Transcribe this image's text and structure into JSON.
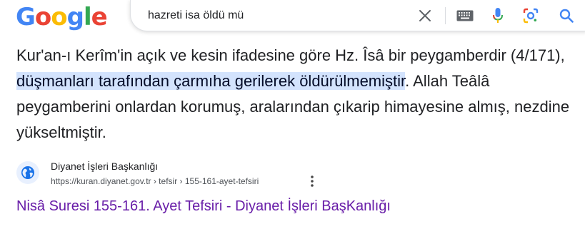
{
  "logo": {
    "letters": [
      "G",
      "o",
      "o",
      "g",
      "l",
      "e"
    ],
    "colors": [
      "#4285f4",
      "#ea4335",
      "#fbbc05",
      "#4285f4",
      "#34a853",
      "#ea4335"
    ]
  },
  "search": {
    "query": "hazreti isa öldü mü",
    "icons": [
      "close-icon",
      "keyboard-icon",
      "microphone-icon",
      "lens-icon",
      "search-icon"
    ]
  },
  "snippet": {
    "text_before": "Kur'an-ı Kerîm'in açık ve kesin ifadesine göre Hz. Îsâ bir peygamberdir (4/171), ",
    "highlight": "düşmanları tarafından çarmıha gerilerek öldürülmemiştir",
    "text_after": ". Allah Teâlâ peygamberini onlardan korumuş, aralarından çıkarip himayesine almış, nezdine yükseltmiştir.",
    "highlight_color": "#d3e3fd"
  },
  "result": {
    "site_name": "Diyanet İşleri Başkanlığı",
    "url": "https://kuran.diyanet.gov.tr › tefsir › 155-161-ayet-tefsiri",
    "title": "Nisâ Suresi 155-161. Ayet Tefsiri - Diyanet İşleri BaşKanlığı",
    "title_color": "#681da8",
    "favicon": "globe-icon"
  }
}
